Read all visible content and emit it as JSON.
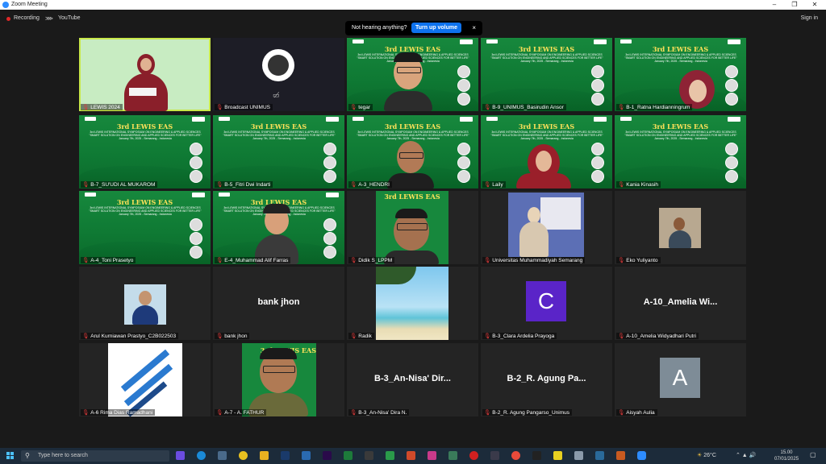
{
  "window": {
    "title": "Zoom Meeting"
  },
  "topbar": {
    "recording": "Recording",
    "youtube": "YouTube",
    "signin": "Sign in"
  },
  "notice": {
    "message": "Not hearing anything?",
    "button": "Turn up volume",
    "close": "×"
  },
  "event": {
    "title": "3rd LEWIS EAS",
    "subtitle": "3rd LEWIS INTERNATIONAL SYMPOSIUM ON ENGINEERING & APPLIED SCIENCES \"SMART SOLUTION ON ENGINEERING AND APPLIED SCIENCES FOR BETTER LIFE\" January 7th, 2025 - Semarang - Indonesia"
  },
  "participants": [
    "LEWIS 2024",
    "Broadcast UNIMUS",
    "tegar",
    "B-9_UNIMUS_Basirudin Ansor",
    "B-1_Ratna Hardianningrum",
    "B-7_SU'UDI AL MUKAROM",
    "B-5_Fitri Dwi Indarti",
    "A-3_HENDRI",
    "Laily",
    "Kania Kinasih",
    "A-4_Toni Prasetyo",
    "E-4_Muhammad Alif Farras",
    "Didik S_LPPM",
    "Universitas Muhammadiyah Semarang",
    "Eko Yuliyanto",
    "Arul Kurniawan Prastyo_C2B022503",
    "bank jhon",
    "Radik",
    "B-3_Clara Ardelia Prayoga",
    "A-10_Amelia Widyadhari Putri",
    "A-6 Rima Dias Ramadhani",
    "A-7 - A. FATHUR",
    "B-3_An-Nisa' Dira N.",
    "B-2_R. Agung Pangarso_Unimus",
    "Aisyah Aulia"
  ],
  "tile_display": {
    "bank_jhon": "bank jhon",
    "amelia": "A-10_Amelia Wi...",
    "annisa": "B-3_An-Nisa' Dir...",
    "agung": "B-2_R. Agung Pa...",
    "clara_letter": "C",
    "aisyah_letter": "A"
  },
  "taskbar": {
    "search_placeholder": "Type here to search",
    "temperature": "26°C",
    "time": "15.00",
    "date": "07/01/2025"
  },
  "colors": {
    "accent": "#0e72ed",
    "active_speaker": "#c8e84a",
    "clara_avatar": "#5a24c8",
    "aisyah_avatar": "#7e8c97",
    "banner_green": "#138a3a"
  }
}
